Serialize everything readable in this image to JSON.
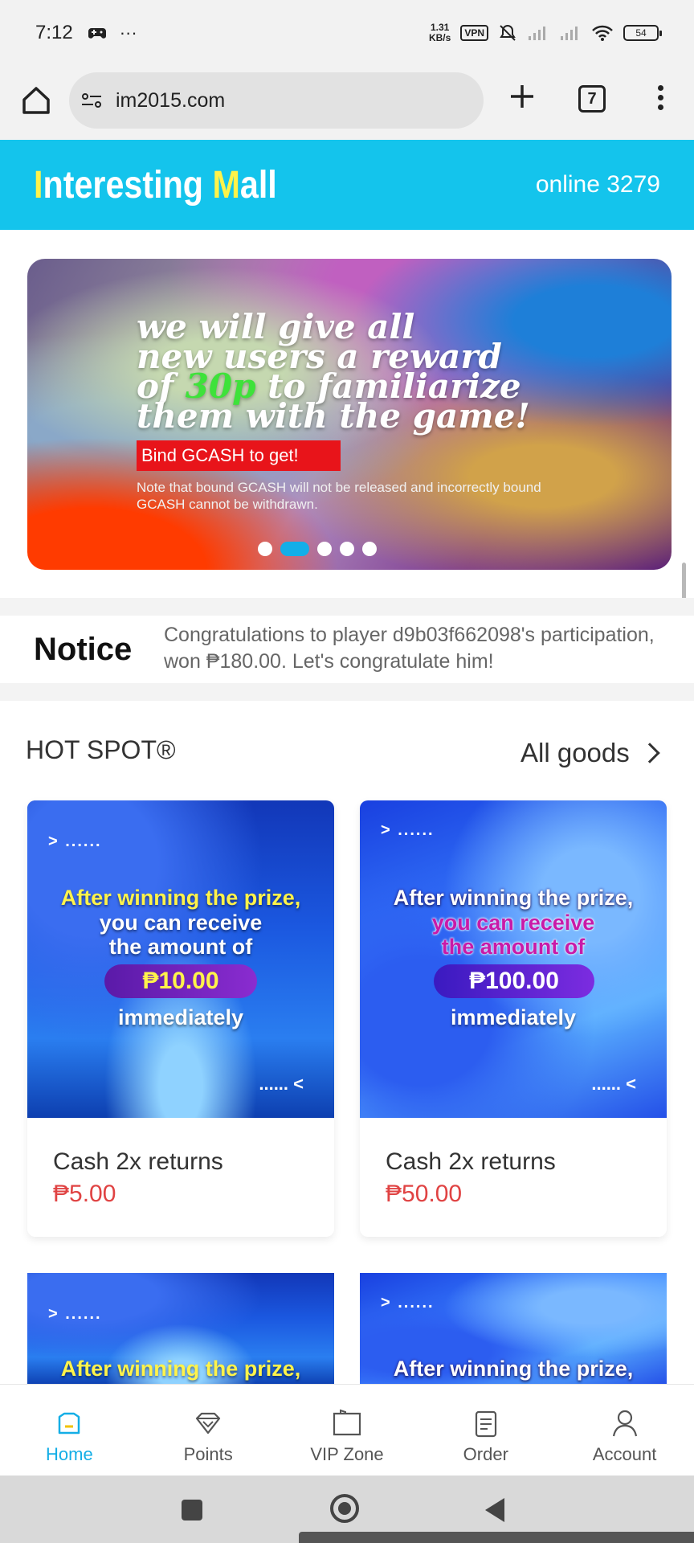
{
  "status_bar": {
    "time": "7:12",
    "left_icons": [
      "game-controller-icon",
      "more-dots-icon"
    ],
    "net_speed_value": "1.31",
    "net_speed_unit": "KB/s",
    "vpn": "VPN",
    "battery": "54"
  },
  "browser": {
    "url": "im2015.com",
    "tab_count": "7"
  },
  "header": {
    "title_part1": "I",
    "title_part2": "nteresting ",
    "title_part3": "M",
    "title_part4": "all",
    "online": "online 3279"
  },
  "banner": {
    "line1": "we will give all",
    "line2": "new users a reward",
    "line3_pre": "of ",
    "line3_hl": "30p",
    "line3_post": " to familiarize",
    "line4": "them with the game!",
    "red_label": "Bind GCASH to get!",
    "note": "Note that bound GCASH will not be released and incorrectly bound GCASH cannot be withdrawn.",
    "slide_count": 5,
    "active_slide": 2
  },
  "notice": {
    "label": "Notice",
    "text": "Congratulations to player d9b03f662098's participation, won ₱180.00. Let's congratulate him!"
  },
  "hot_spot": {
    "title": "HOT SPOT®",
    "all_goods": "All goods"
  },
  "products": [
    {
      "arrow": "> ......",
      "line1": "After winning the prize,",
      "line2": "you can receive",
      "line3": "the amount of",
      "amount": "₱10.00",
      "line4": "immediately",
      "back": "...... <",
      "name": "Cash 2x returns",
      "price": "₱5.00"
    },
    {
      "arrow": "> ......",
      "line1": "After winning the prize,",
      "line2": "you can receive",
      "line3": "the amount of",
      "amount": "₱100.00",
      "line4": "immediately",
      "back": "...... <",
      "name": "Cash 2x returns",
      "price": "₱50.00"
    },
    {
      "arrow": "> ......",
      "line1": "After winning the prize,"
    },
    {
      "arrow": "> ......",
      "line1": "After winning the prize,"
    }
  ],
  "bottom_nav": [
    {
      "label": "Home",
      "icon": "home-icon",
      "active": true
    },
    {
      "label": "Points",
      "icon": "diamond-icon",
      "active": false
    },
    {
      "label": "VIP Zone",
      "icon": "folder-icon",
      "active": false
    },
    {
      "label": "Order",
      "icon": "order-list-icon",
      "active": false
    },
    {
      "label": "Account",
      "icon": "person-icon",
      "active": false
    }
  ],
  "colors": {
    "header_bg": "#14c4ec",
    "accent": "#14aee6",
    "price": "#e04343",
    "title_highlight": "#fff34a"
  }
}
